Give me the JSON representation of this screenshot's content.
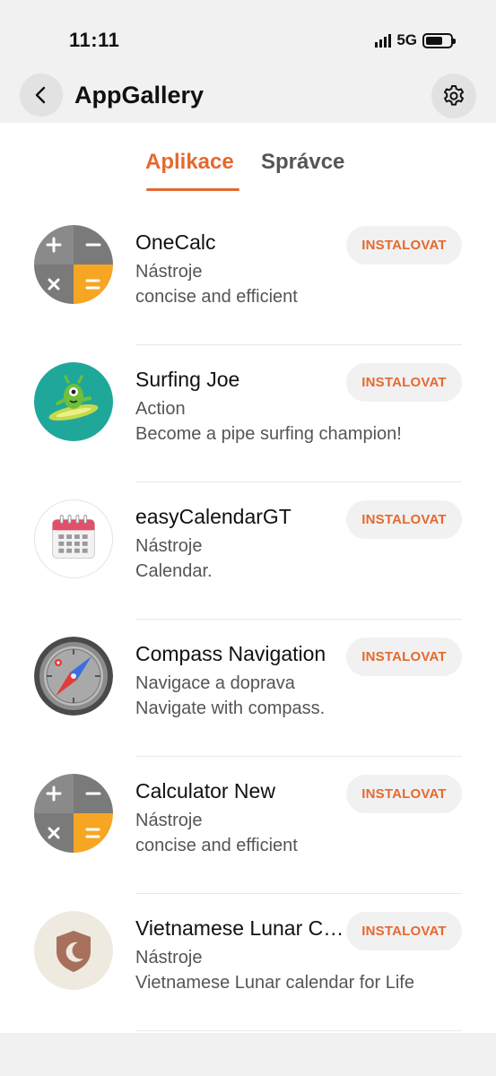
{
  "status": {
    "time": "11:11",
    "network": "5G"
  },
  "header": {
    "title": "AppGallery",
    "back_icon": "chevron-left-icon",
    "settings_icon": "gear-icon"
  },
  "tabs": [
    {
      "label": "Aplikace",
      "active": true
    },
    {
      "label": "Správce",
      "active": false
    }
  ],
  "colors": {
    "accent": "#e5692f",
    "button_bg": "#f1f1f1"
  },
  "apps": [
    {
      "name": "OneCalc",
      "category": "Nástroje",
      "description": "concise and efficient",
      "icon": "calculator-icon",
      "button": "INSTALOVAT"
    },
    {
      "name": "Surfing Joe",
      "category": "Action",
      "description": "Become a pipe surfing champion!",
      "icon": "surfing-alien-icon",
      "button": "INSTALOVAT"
    },
    {
      "name": "easyCalendarGT",
      "category": "Nástroje",
      "description": "Calendar.",
      "icon": "calendar-icon",
      "button": "INSTALOVAT"
    },
    {
      "name": "Compass Navigation",
      "category": "Navigace a doprava",
      "description": "Navigate with compass.",
      "icon": "compass-icon",
      "button": "INSTALOVAT"
    },
    {
      "name": "Calculator New",
      "category": "Nástroje",
      "description": "concise and efficient",
      "icon": "calculator-icon",
      "button": "INSTALOVAT"
    },
    {
      "name": "Vietnamese Lunar Calendar",
      "category": "Nástroje",
      "description": "Vietnamese Lunar calendar for Life",
      "icon": "moon-shield-icon",
      "button": "INSTALOVAT"
    }
  ]
}
